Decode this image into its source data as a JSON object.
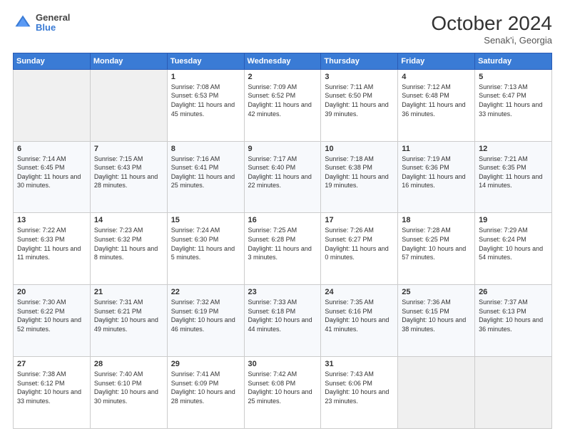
{
  "header": {
    "logo_line1": "General",
    "logo_line2": "Blue",
    "month_year": "October 2024",
    "location": "Senak'i, Georgia"
  },
  "days_of_week": [
    "Sunday",
    "Monday",
    "Tuesday",
    "Wednesday",
    "Thursday",
    "Friday",
    "Saturday"
  ],
  "weeks": [
    [
      {
        "day": "",
        "empty": true
      },
      {
        "day": "",
        "empty": true
      },
      {
        "day": "1",
        "sunrise": "7:08 AM",
        "sunset": "6:53 PM",
        "daylight": "11 hours and 45 minutes."
      },
      {
        "day": "2",
        "sunrise": "7:09 AM",
        "sunset": "6:52 PM",
        "daylight": "11 hours and 42 minutes."
      },
      {
        "day": "3",
        "sunrise": "7:11 AM",
        "sunset": "6:50 PM",
        "daylight": "11 hours and 39 minutes."
      },
      {
        "day": "4",
        "sunrise": "7:12 AM",
        "sunset": "6:48 PM",
        "daylight": "11 hours and 36 minutes."
      },
      {
        "day": "5",
        "sunrise": "7:13 AM",
        "sunset": "6:47 PM",
        "daylight": "11 hours and 33 minutes."
      }
    ],
    [
      {
        "day": "6",
        "sunrise": "7:14 AM",
        "sunset": "6:45 PM",
        "daylight": "11 hours and 30 minutes."
      },
      {
        "day": "7",
        "sunrise": "7:15 AM",
        "sunset": "6:43 PM",
        "daylight": "11 hours and 28 minutes."
      },
      {
        "day": "8",
        "sunrise": "7:16 AM",
        "sunset": "6:41 PM",
        "daylight": "11 hours and 25 minutes."
      },
      {
        "day": "9",
        "sunrise": "7:17 AM",
        "sunset": "6:40 PM",
        "daylight": "11 hours and 22 minutes."
      },
      {
        "day": "10",
        "sunrise": "7:18 AM",
        "sunset": "6:38 PM",
        "daylight": "11 hours and 19 minutes."
      },
      {
        "day": "11",
        "sunrise": "7:19 AM",
        "sunset": "6:36 PM",
        "daylight": "11 hours and 16 minutes."
      },
      {
        "day": "12",
        "sunrise": "7:21 AM",
        "sunset": "6:35 PM",
        "daylight": "11 hours and 14 minutes."
      }
    ],
    [
      {
        "day": "13",
        "sunrise": "7:22 AM",
        "sunset": "6:33 PM",
        "daylight": "11 hours and 11 minutes."
      },
      {
        "day": "14",
        "sunrise": "7:23 AM",
        "sunset": "6:32 PM",
        "daylight": "11 hours and 8 minutes."
      },
      {
        "day": "15",
        "sunrise": "7:24 AM",
        "sunset": "6:30 PM",
        "daylight": "11 hours and 5 minutes."
      },
      {
        "day": "16",
        "sunrise": "7:25 AM",
        "sunset": "6:28 PM",
        "daylight": "11 hours and 3 minutes."
      },
      {
        "day": "17",
        "sunrise": "7:26 AM",
        "sunset": "6:27 PM",
        "daylight": "11 hours and 0 minutes."
      },
      {
        "day": "18",
        "sunrise": "7:28 AM",
        "sunset": "6:25 PM",
        "daylight": "10 hours and 57 minutes."
      },
      {
        "day": "19",
        "sunrise": "7:29 AM",
        "sunset": "6:24 PM",
        "daylight": "10 hours and 54 minutes."
      }
    ],
    [
      {
        "day": "20",
        "sunrise": "7:30 AM",
        "sunset": "6:22 PM",
        "daylight": "10 hours and 52 minutes."
      },
      {
        "day": "21",
        "sunrise": "7:31 AM",
        "sunset": "6:21 PM",
        "daylight": "10 hours and 49 minutes."
      },
      {
        "day": "22",
        "sunrise": "7:32 AM",
        "sunset": "6:19 PM",
        "daylight": "10 hours and 46 minutes."
      },
      {
        "day": "23",
        "sunrise": "7:33 AM",
        "sunset": "6:18 PM",
        "daylight": "10 hours and 44 minutes."
      },
      {
        "day": "24",
        "sunrise": "7:35 AM",
        "sunset": "6:16 PM",
        "daylight": "10 hours and 41 minutes."
      },
      {
        "day": "25",
        "sunrise": "7:36 AM",
        "sunset": "6:15 PM",
        "daylight": "10 hours and 38 minutes."
      },
      {
        "day": "26",
        "sunrise": "7:37 AM",
        "sunset": "6:13 PM",
        "daylight": "10 hours and 36 minutes."
      }
    ],
    [
      {
        "day": "27",
        "sunrise": "7:38 AM",
        "sunset": "6:12 PM",
        "daylight": "10 hours and 33 minutes."
      },
      {
        "day": "28",
        "sunrise": "7:40 AM",
        "sunset": "6:10 PM",
        "daylight": "10 hours and 30 minutes."
      },
      {
        "day": "29",
        "sunrise": "7:41 AM",
        "sunset": "6:09 PM",
        "daylight": "10 hours and 28 minutes."
      },
      {
        "day": "30",
        "sunrise": "7:42 AM",
        "sunset": "6:08 PM",
        "daylight": "10 hours and 25 minutes."
      },
      {
        "day": "31",
        "sunrise": "7:43 AM",
        "sunset": "6:06 PM",
        "daylight": "10 hours and 23 minutes."
      },
      {
        "day": "",
        "empty": true
      },
      {
        "day": "",
        "empty": true
      }
    ]
  ]
}
